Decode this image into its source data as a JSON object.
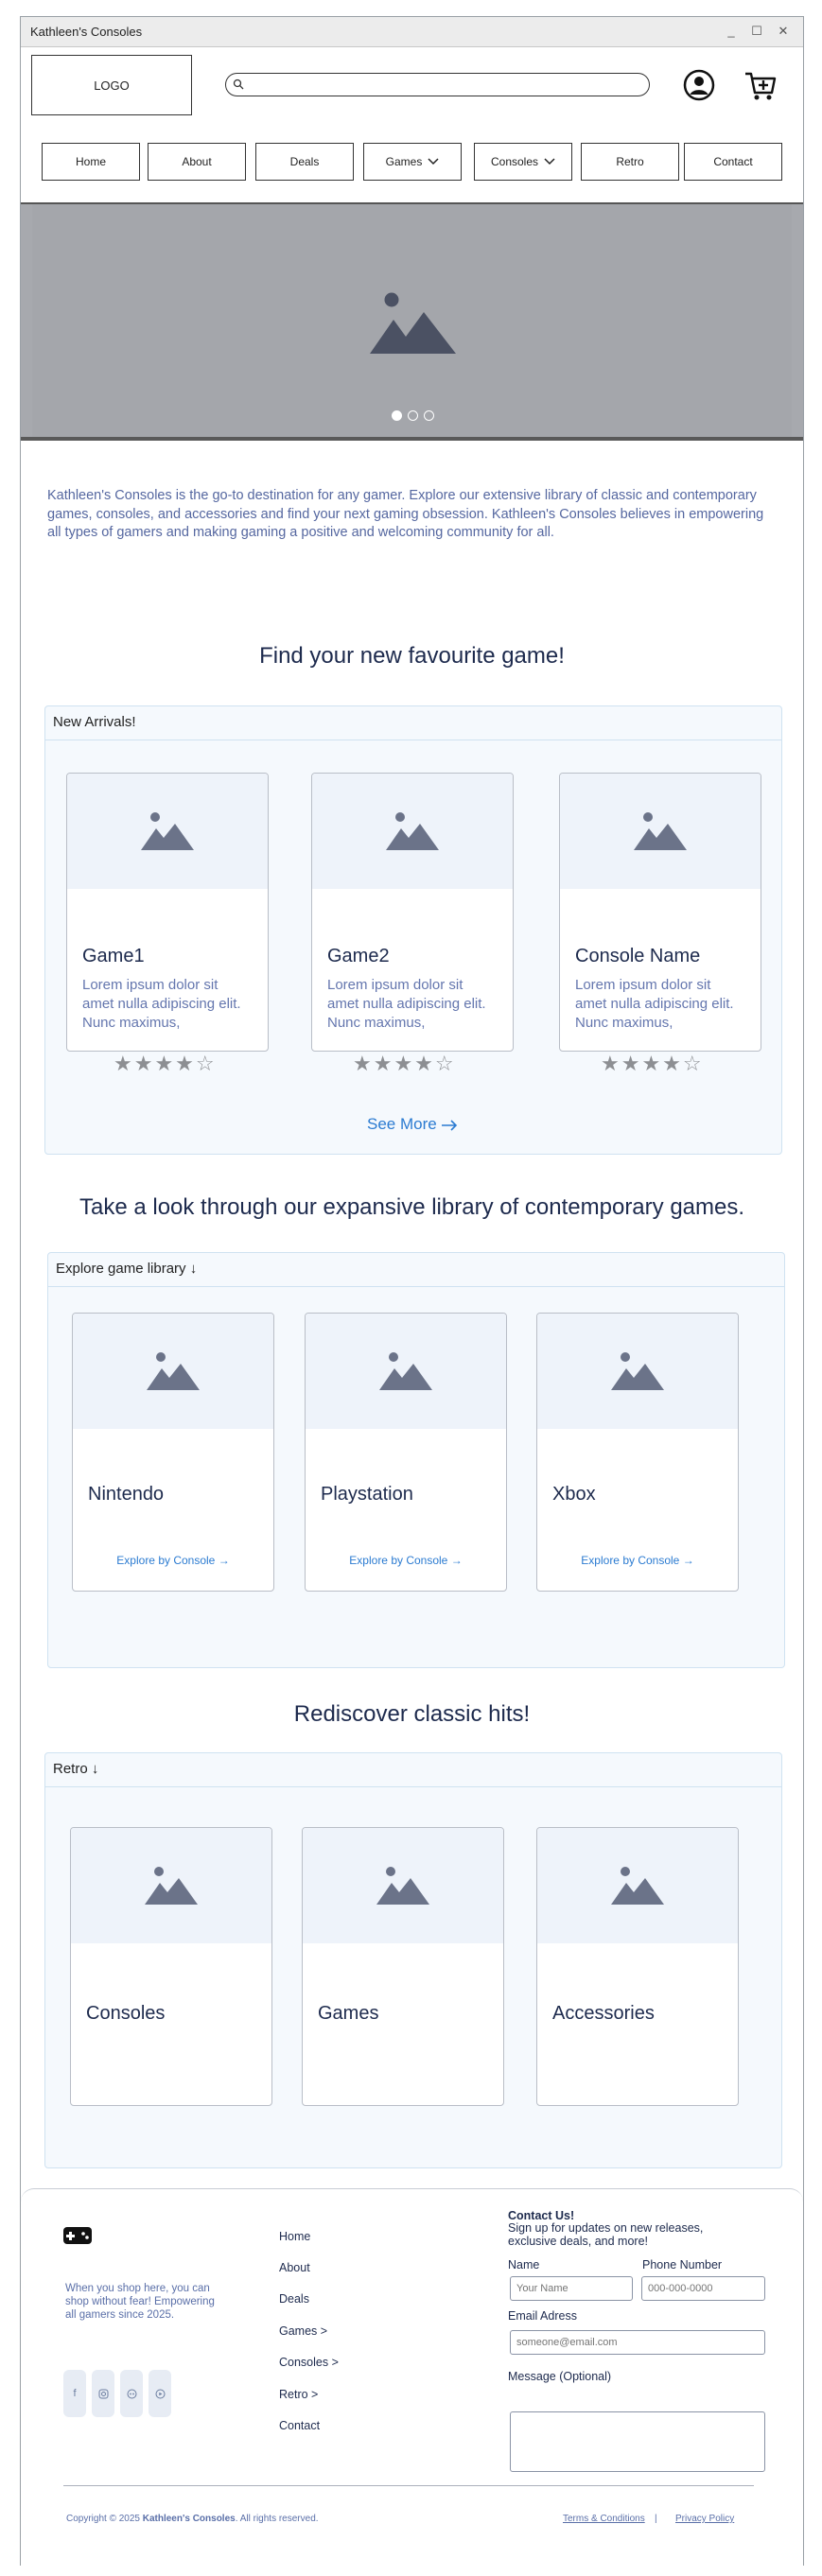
{
  "window": {
    "title": "Kathleen's Consoles",
    "controls": [
      "_",
      "☐",
      "✕"
    ]
  },
  "header": {
    "logo_label": "LOGO",
    "search_placeholder": "",
    "user_icon": "user-circle-icon",
    "cart_icon": "cart-plus-icon"
  },
  "nav": {
    "items": [
      {
        "label": "Home",
        "dropdown": false
      },
      {
        "label": "About",
        "dropdown": false
      },
      {
        "label": "Deals",
        "dropdown": false
      },
      {
        "label": "Games",
        "dropdown": true
      },
      {
        "label": "Consoles",
        "dropdown": true
      },
      {
        "label": "Retro",
        "dropdown": false
      },
      {
        "label": "Contact",
        "dropdown": false
      }
    ]
  },
  "hero": {
    "image_icon": "image-placeholder-icon",
    "slide_count": 3,
    "active_slide": 1
  },
  "intro": {
    "text": "Kathleen's Consoles is the go-to destination for any gamer. Explore our extensive library of classic and contemporary games, consoles, and accessories and find your next gaming obsession. Kathleen's Consoles believes in empowering all types of gamers and making gaming a positive and welcoming community for all."
  },
  "new_arrivals": {
    "section_title": "Find your new favourite game!",
    "panel_title": "New Arrivals!",
    "cards": [
      {
        "title": "Game1",
        "description": "Lorem ipsum dolor sit amet nulla adipiscing elit. Nunc maximus,",
        "rating": 4,
        "max_rating": 5
      },
      {
        "title": "Game2",
        "description": "Lorem ipsum dolor sit amet nulla adipiscing elit. Nunc maximus,",
        "rating": 4,
        "max_rating": 5
      },
      {
        "title": "Console Name",
        "description": "Lorem ipsum dolor sit amet nulla adipiscing elit. Nunc maximus,",
        "rating": 4,
        "max_rating": 5
      }
    ],
    "see_more_label": "See More"
  },
  "library": {
    "section_title": "Take a look through our expansive library of contemporary games.",
    "panel_title": "Explore game library ↓",
    "cards": [
      {
        "title": "Nintendo",
        "link": "Explore by Console →"
      },
      {
        "title": "Playstation",
        "link": "Explore by Console →"
      },
      {
        "title": "Xbox",
        "link": "Explore by Console →"
      }
    ]
  },
  "retro": {
    "section_title": "Rediscover classic hits!",
    "panel_title": "Retro ↓",
    "cards": [
      {
        "title": "Consoles"
      },
      {
        "title": "Games"
      },
      {
        "title": "Accessories"
      }
    ]
  },
  "footer": {
    "logo_icon": "gamepad-icon",
    "tagline": "When you shop here, you can shop without fear! Empowering all gamers since 2025.",
    "social_icons": [
      "facebook-icon",
      "instagram-icon",
      "discord-icon",
      "youtube-icon"
    ],
    "links": [
      "Home",
      "About",
      "Deals",
      "Games >",
      "Consoles >",
      "Retro >",
      "Contact"
    ],
    "contact": {
      "heading": "Contact Us!",
      "subheading": "Sign up for updates on new releases, exclusive deals, and more!",
      "name_label": "Name",
      "name_placeholder": "Your Name",
      "phone_label": "Phone Number",
      "phone_placeholder": "000-000-0000",
      "email_label": "Email Adress",
      "email_placeholder": "someone@email.com",
      "message_label": "Message (Optional)"
    },
    "copyright_prefix": "Copyright © 2025 ",
    "copyright_brand": "Kathleen's Consoles",
    "copyright_suffix": ". All rights reserved.",
    "terms_label": "Terms & Conditions",
    "separator": "|",
    "privacy_label": "Privacy Policy"
  },
  "colors": {
    "accent": "#2b7bd1",
    "heading": "#1d2a4d",
    "body_text": "#6476ae",
    "panel_bg": "#f5f9fd",
    "hero_bg": "#a4a6ab"
  }
}
